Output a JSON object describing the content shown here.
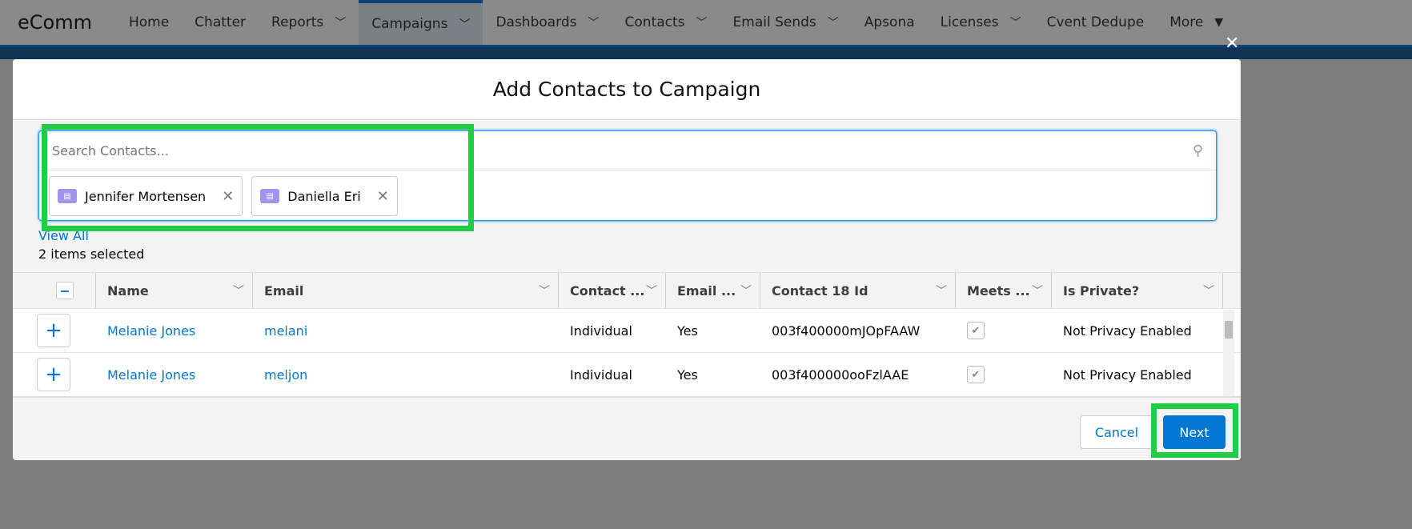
{
  "nav": {
    "brand": "eComm",
    "items": [
      {
        "label": "Home",
        "dd": false
      },
      {
        "label": "Chatter",
        "dd": false
      },
      {
        "label": "Reports",
        "dd": true
      },
      {
        "label": "Campaigns",
        "dd": true,
        "active": true
      },
      {
        "label": "Dashboards",
        "dd": true
      },
      {
        "label": "Contacts",
        "dd": true
      },
      {
        "label": "Email Sends",
        "dd": true
      },
      {
        "label": "Apsona",
        "dd": false
      },
      {
        "label": "Licenses",
        "dd": true
      },
      {
        "label": "Cvent Dedupe",
        "dd": false
      },
      {
        "label": "More",
        "dd": true
      }
    ]
  },
  "modal": {
    "title": "Add Contacts to Campaign",
    "close": "✕",
    "search": {
      "placeholder": "Search Contacts...",
      "value": ""
    },
    "pills": [
      "Jennifer Mortensen",
      "Daniella Eri"
    ],
    "view_all": "View All",
    "selected_count": "2 items selected",
    "columns": [
      "Name",
      "Email",
      "Contact ...",
      "Email ...",
      "Contact 18 Id",
      "Meets ...",
      "Is Private?"
    ],
    "rows": [
      {
        "name": "Melanie Jones",
        "email": "melani",
        "type": "Individual",
        "email_opt": "Yes",
        "id18": "003f400000mJOpFAAW",
        "meets": true,
        "private": "Not Privacy Enabled"
      },
      {
        "name": "Melanie Jones",
        "email": "meljon",
        "type": "Individual",
        "email_opt": "Yes",
        "id18": "003f400000ooFzlAAE",
        "meets": true,
        "private": "Not Privacy Enabled"
      }
    ],
    "cancel": "Cancel",
    "next": "Next"
  },
  "colors": {
    "brand": "#0176d3",
    "highlight": "#22cc44",
    "contact_icon": "#a094ed"
  }
}
